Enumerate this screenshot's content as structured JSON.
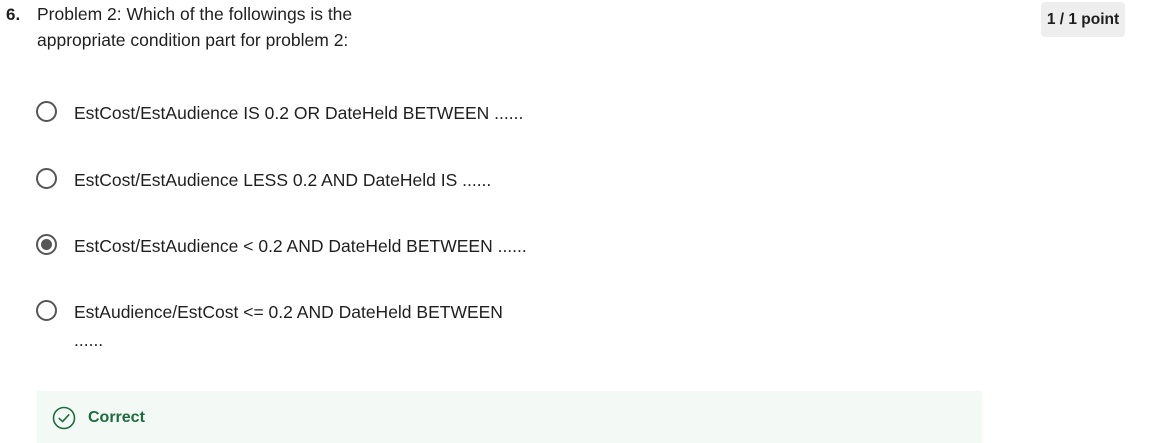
{
  "question": {
    "number": "6.",
    "text_line1": "Problem 2: Which of the followings is the",
    "text_line2": "appropriate condition part for problem 2:",
    "points": "1 / 1 point"
  },
  "options": [
    {
      "label": "EstCost/EstAudience IS 0.2 OR DateHeld BETWEEN ......",
      "selected": false
    },
    {
      "label": "EstCost/EstAudience LESS 0.2 AND DateHeld IS ......",
      "selected": false
    },
    {
      "label": "EstCost/EstAudience < 0.2 AND DateHeld BETWEEN ......",
      "selected": true
    },
    {
      "label": "EstAudience/EstCost <= 0.2 AND DateHeld BETWEEN ......",
      "selected": false
    }
  ],
  "feedback": {
    "label": "Correct",
    "icon": "check-circle-icon",
    "color": "#1e6b3e",
    "background": "#f3faf6"
  }
}
